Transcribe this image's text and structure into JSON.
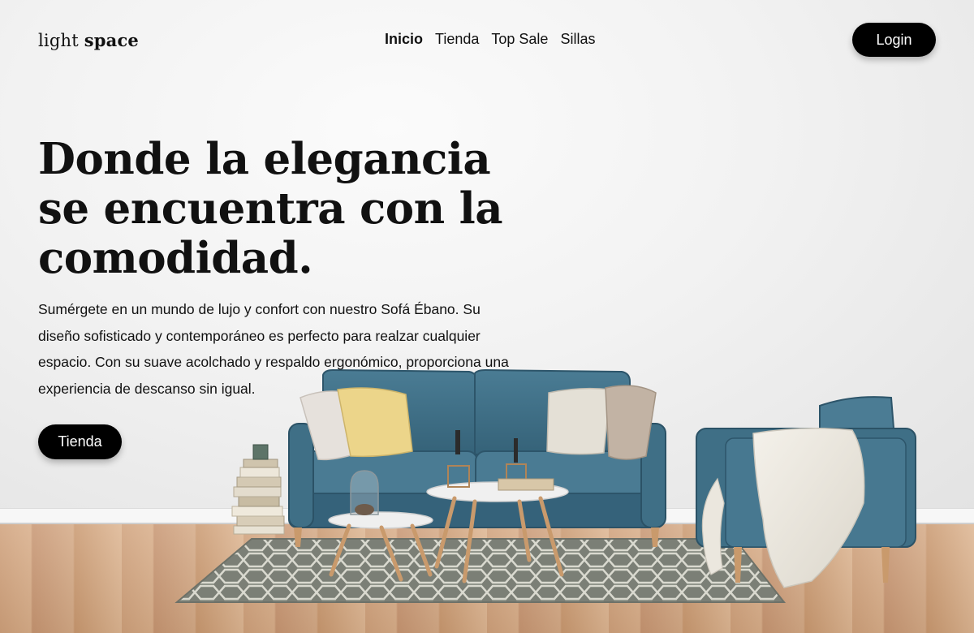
{
  "brand": {
    "logo_light": "light",
    "logo_space": "space"
  },
  "nav": {
    "items": [
      {
        "label": "Inicio",
        "active": true
      },
      {
        "label": "Tienda",
        "active": false
      },
      {
        "label": "Top Sale",
        "active": false
      },
      {
        "label": "Sillas",
        "active": false
      }
    ]
  },
  "header": {
    "login_label": "Login"
  },
  "hero": {
    "title": "Donde la elegancia se encuentra con la comodidad.",
    "description": "Sumérgete en un mundo de lujo y confort con nuestro Sofá Ébano. Su diseño sofisticado y contemporáneo es perfecto para realzar cualquier espacio. Con su suave acolchado y respaldo ergonómico, proporciona una experiencia de descanso sin igual.",
    "cta_label": "Tienda"
  },
  "colors": {
    "button_bg": "#000000",
    "button_text": "#ffffff",
    "sofa": "#3f6f86",
    "floor": "#d3a680",
    "rug": "#7b7f76"
  }
}
